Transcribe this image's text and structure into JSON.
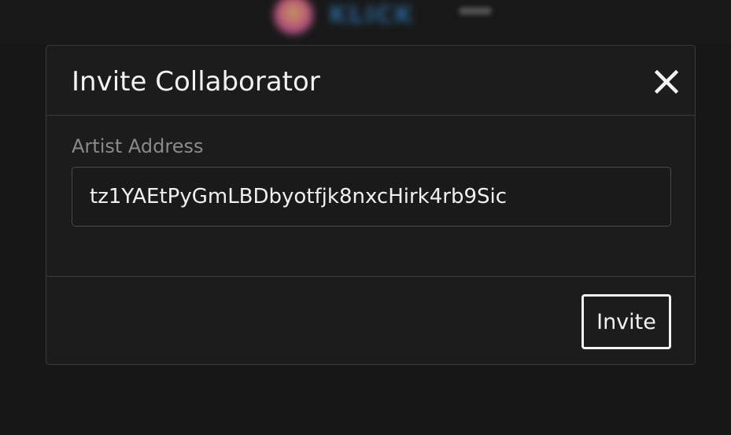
{
  "background": {
    "logo_text": "KLICK"
  },
  "modal": {
    "title": "Invite Collaborator",
    "close_icon": "close-icon",
    "field_label": "Artist Address",
    "address_value": "tz1YAEtPyGmLBDbyotfjk8nxcHirk4rb9Sic",
    "invite_label": "Invite"
  },
  "colors": {
    "page_background": "#171717",
    "modal_background": "#1c1c1c",
    "border": "#3a3a3a",
    "text": "#f2f2f2",
    "muted_text": "#8a8a8a"
  }
}
